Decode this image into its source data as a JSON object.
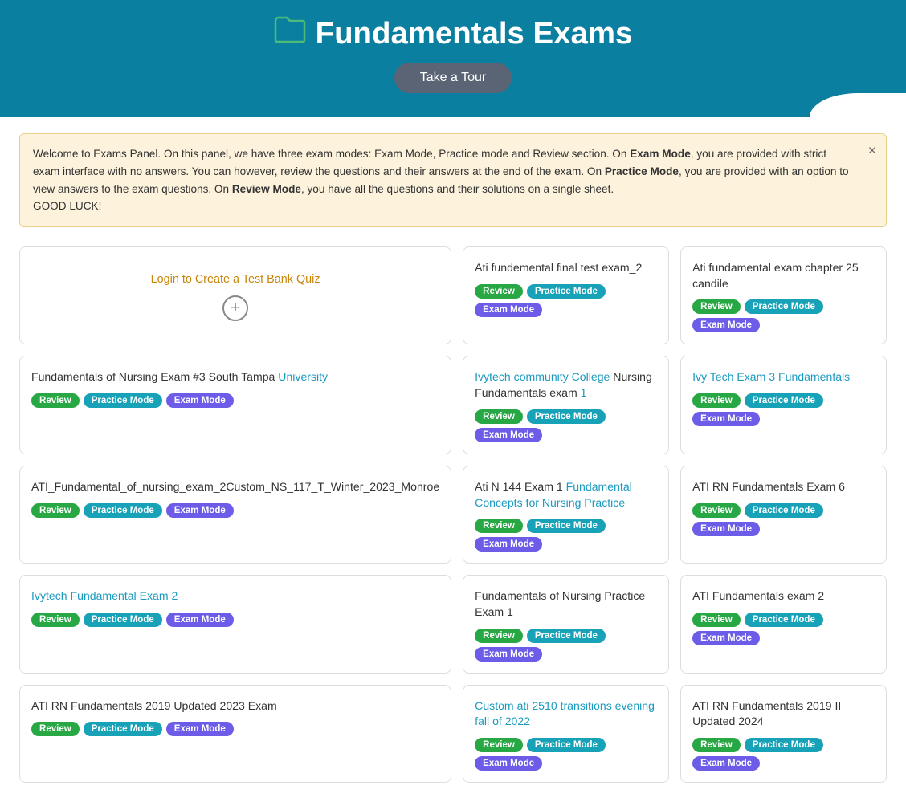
{
  "header": {
    "title": "Fundamentals Exams",
    "folder_icon": "🗂",
    "tour_button": "Take a Tour"
  },
  "alert": {
    "text_start": "Welcome to Exams Panel. On this panel, we have three exam modes: Exam Mode, Practice mode and Review section. On ",
    "exam_mode_label": "Exam Mode",
    "text_mid1": ", you are provided with strict exam interface with no answers. You can however, review the questions and their answers at the end of the exam. On ",
    "practice_mode_label": "Practice Mode",
    "text_mid2": ", you are provided with an option to view answers to the exam questions. On ",
    "review_mode_label": "Review Mode",
    "text_mid3": ", you have all the questions and their solutions on a single sheet.",
    "good_luck": "GOOD LUCK!"
  },
  "cards": [
    {
      "id": "login-card",
      "type": "login",
      "title": "Login to Create a Test Bank Quiz",
      "badges": []
    },
    {
      "id": "ati-fundemental-final",
      "title": "Ati fundemental final test exam_2",
      "badges": [
        "Review",
        "Practice Mode",
        "Exam Mode"
      ]
    },
    {
      "id": "ati-fundamental-chapter25",
      "title": "Ati fundamental exam chapter 25 candile",
      "badges": [
        "Review",
        "Practice Mode",
        "Exam Mode"
      ]
    },
    {
      "id": "fundamentals-nursing-3",
      "title_parts": [
        "Fundamentals of Nursing Exam #3 South Tampa ",
        "University"
      ],
      "title": "Fundamentals of Nursing Exam #3 South Tampa University",
      "badges": [
        "Review",
        "Practice Mode",
        "Exam Mode"
      ]
    },
    {
      "id": "ivytech-community",
      "title": "Ivytech community College Nursing Fundamentals exam 1",
      "badges": [
        "Review",
        "Practice Mode",
        "Exam Mode"
      ]
    },
    {
      "id": "ivy-tech-exam3",
      "title": "Ivy Tech Exam 3 Fundamentals",
      "badges": [
        "Review",
        "Practice Mode",
        "Exam Mode"
      ]
    },
    {
      "id": "ati-fundamental-custom",
      "title": "ATI_Fundamental_of_nursing_exam_2Custom_NS_117_T_Winter_2023_Monroe",
      "badges": [
        "Review",
        "Practice Mode",
        "Exam Mode"
      ]
    },
    {
      "id": "ati-n144",
      "title": "Ati N 144 Exam 1 Fundamental Concepts for Nursing Practice",
      "badges": [
        "Review",
        "Practice Mode",
        "Exam Mode"
      ]
    },
    {
      "id": "ati-rn-fundamentals-6",
      "title": "ATI RN Fundamentals Exam 6",
      "badges": [
        "Review",
        "Practice Mode",
        "Exam Mode"
      ]
    },
    {
      "id": "ivytech-fundamental-2",
      "title": "Ivytech Fundamental Exam 2",
      "badges": [
        "Review",
        "Practice Mode",
        "Exam Mode"
      ]
    },
    {
      "id": "fundamentals-nursing-practice-1",
      "title": "Fundamentals of Nursing Practice Exam 1",
      "badges": [
        "Review",
        "Practice Mode",
        "Exam Mode"
      ]
    },
    {
      "id": "ati-fundamentals-exam2",
      "title": "ATI Fundamentals exam 2",
      "badges": [
        "Review",
        "Practice Mode",
        "Exam Mode"
      ]
    },
    {
      "id": "ati-rn-2019-2023",
      "title": "ATI RN Fundamentals 2019 Updated 2023 Exam",
      "badges": [
        "Review",
        "Practice Mode",
        "Exam Mode"
      ]
    },
    {
      "id": "custom-ati-2510",
      "title": "Custom ati 2510 transitions evening fall of 2022",
      "badges": [
        "Review",
        "Practice Mode",
        "Exam Mode"
      ]
    },
    {
      "id": "ati-rn-2019-ii-2024",
      "title": "ATI RN Fundamentals 2019 II Updated 2024",
      "badges": [
        "Review",
        "Practice Mode",
        "Exam Mode"
      ]
    }
  ],
  "badge_labels": {
    "review": "Review",
    "practice": "Practice Mode",
    "exam": "Exam Mode"
  }
}
